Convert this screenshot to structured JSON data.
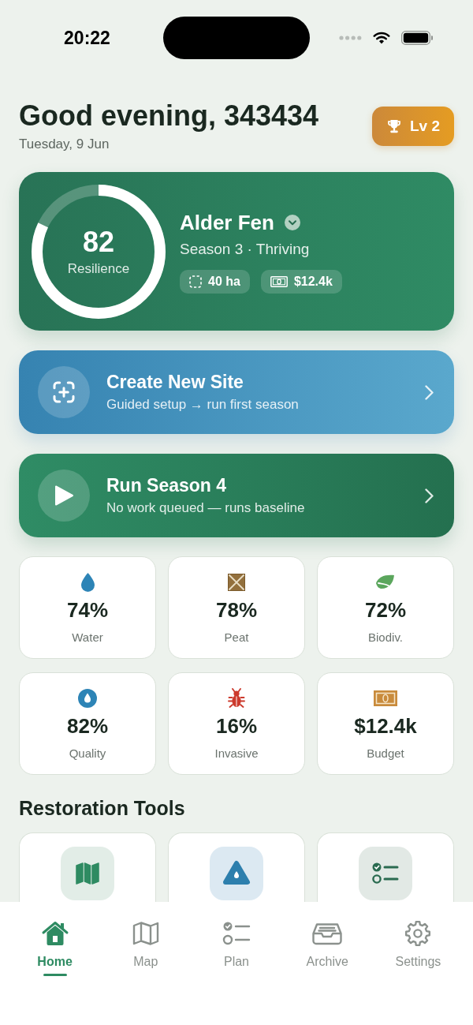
{
  "status_bar": {
    "time": "20:22"
  },
  "header": {
    "greeting": "Good evening, 343434",
    "date": "Tuesday, 9 Jun",
    "level_badge": "Lv 2"
  },
  "site_card": {
    "score": "82",
    "score_label": "Resilience",
    "level": 0.82,
    "name": "Alder Fen",
    "subtitle": "Season 3 · Thriving",
    "chips": [
      {
        "kind": "area",
        "label": "40 ha"
      },
      {
        "kind": "budget",
        "label": "$12.4k"
      }
    ]
  },
  "actions": [
    {
      "kind": "create",
      "title": "Create New Site",
      "subtitle": "Guided setup → run first season"
    },
    {
      "kind": "run",
      "title": "Run Season 4",
      "subtitle": "No work queued — runs baseline"
    }
  ],
  "stats": [
    {
      "kind": "water",
      "value": "74%",
      "label": "Water"
    },
    {
      "kind": "peat",
      "value": "78%",
      "label": "Peat"
    },
    {
      "kind": "biodiversity",
      "value": "72%",
      "label": "Biodiv."
    },
    {
      "kind": "quality",
      "value": "82%",
      "label": "Quality"
    },
    {
      "kind": "invasive",
      "value": "16%",
      "label": "Invasive"
    },
    {
      "kind": "budget",
      "value": "$12.4k",
      "label": "Budget"
    }
  ],
  "tools": {
    "title": "Restoration Tools",
    "items": [
      {
        "kind": "map"
      },
      {
        "kind": "water"
      },
      {
        "kind": "plan"
      }
    ]
  },
  "tab_bar": [
    {
      "kind": "home",
      "label": "Home",
      "selected": true
    },
    {
      "kind": "map",
      "label": "Map",
      "selected": false
    },
    {
      "kind": "plan",
      "label": "Plan",
      "selected": false
    },
    {
      "kind": "archive",
      "label": "Archive",
      "selected": false
    },
    {
      "kind": "settings",
      "label": "Settings",
      "selected": false
    }
  ]
}
